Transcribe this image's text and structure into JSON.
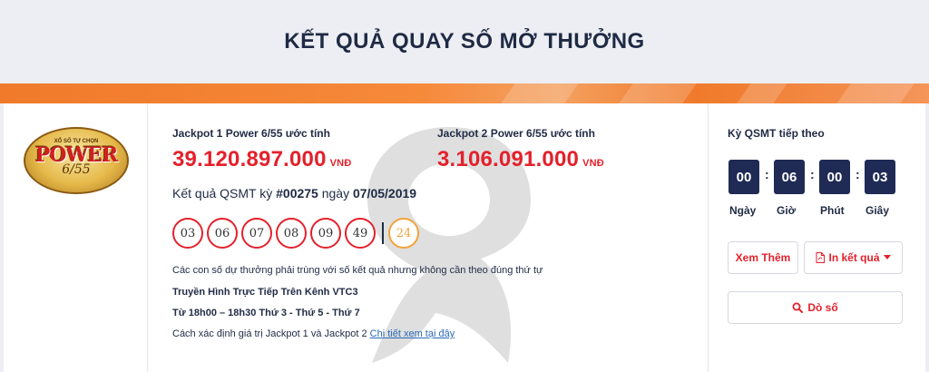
{
  "page": {
    "title": "KẾT QUẢ QUAY SỐ MỞ THƯỞNG"
  },
  "logo": {
    "top_text": "XỔ SỐ TỰ CHỌN",
    "word": "POWER",
    "number": "6/55"
  },
  "jackpot1": {
    "label": "Jackpot 1 Power 6/55 ước tính",
    "value": "39.120.897.000",
    "currency": "VNĐ"
  },
  "jackpot2": {
    "label": "Jackpot 2 Power 6/55 ước tính",
    "value": "3.106.091.000",
    "currency": "VNĐ"
  },
  "result": {
    "prefix": "Kết quả QSMT kỳ ",
    "draw_id": "#00275",
    "mid": " ngày ",
    "date": "07/05/2019"
  },
  "numbers": [
    "03",
    "06",
    "07",
    "08",
    "09",
    "49"
  ],
  "bonus_number": "24",
  "info": {
    "rule": "Các con số dự thưởng phải trùng với số kết quả nhưng không cần theo đúng thứ tự",
    "channel": "Truyền Hình Trực Tiếp Trên Kênh VTC3",
    "schedule": "Từ 18h00 – 18h30 Thứ 3 - Thứ 5 - Thứ 7",
    "jackpot_note": "Cách xác định giá trị Jackpot 1 và Jackpot 2 ",
    "jackpot_link": "Chi tiết xem tại đây"
  },
  "countdown": {
    "label": "Kỳ QSMT tiếp theo",
    "days": "00",
    "hours": "06",
    "minutes": "00",
    "seconds": "03",
    "days_label": "Ngày",
    "hours_label": "Giờ",
    "minutes_label": "Phút",
    "seconds_label": "Giây"
  },
  "buttons": {
    "more": "Xem Thêm",
    "print": "In kết quả",
    "check": "Dò số"
  },
  "colors": {
    "accent_red": "#e3212c",
    "navy": "#1f2a55",
    "bonus_orange": "#f2a33a",
    "band_orange": "#f07a2a"
  },
  "icons": {
    "print": "pdf-icon",
    "caret": "caret-down-icon",
    "search": "search-icon"
  }
}
